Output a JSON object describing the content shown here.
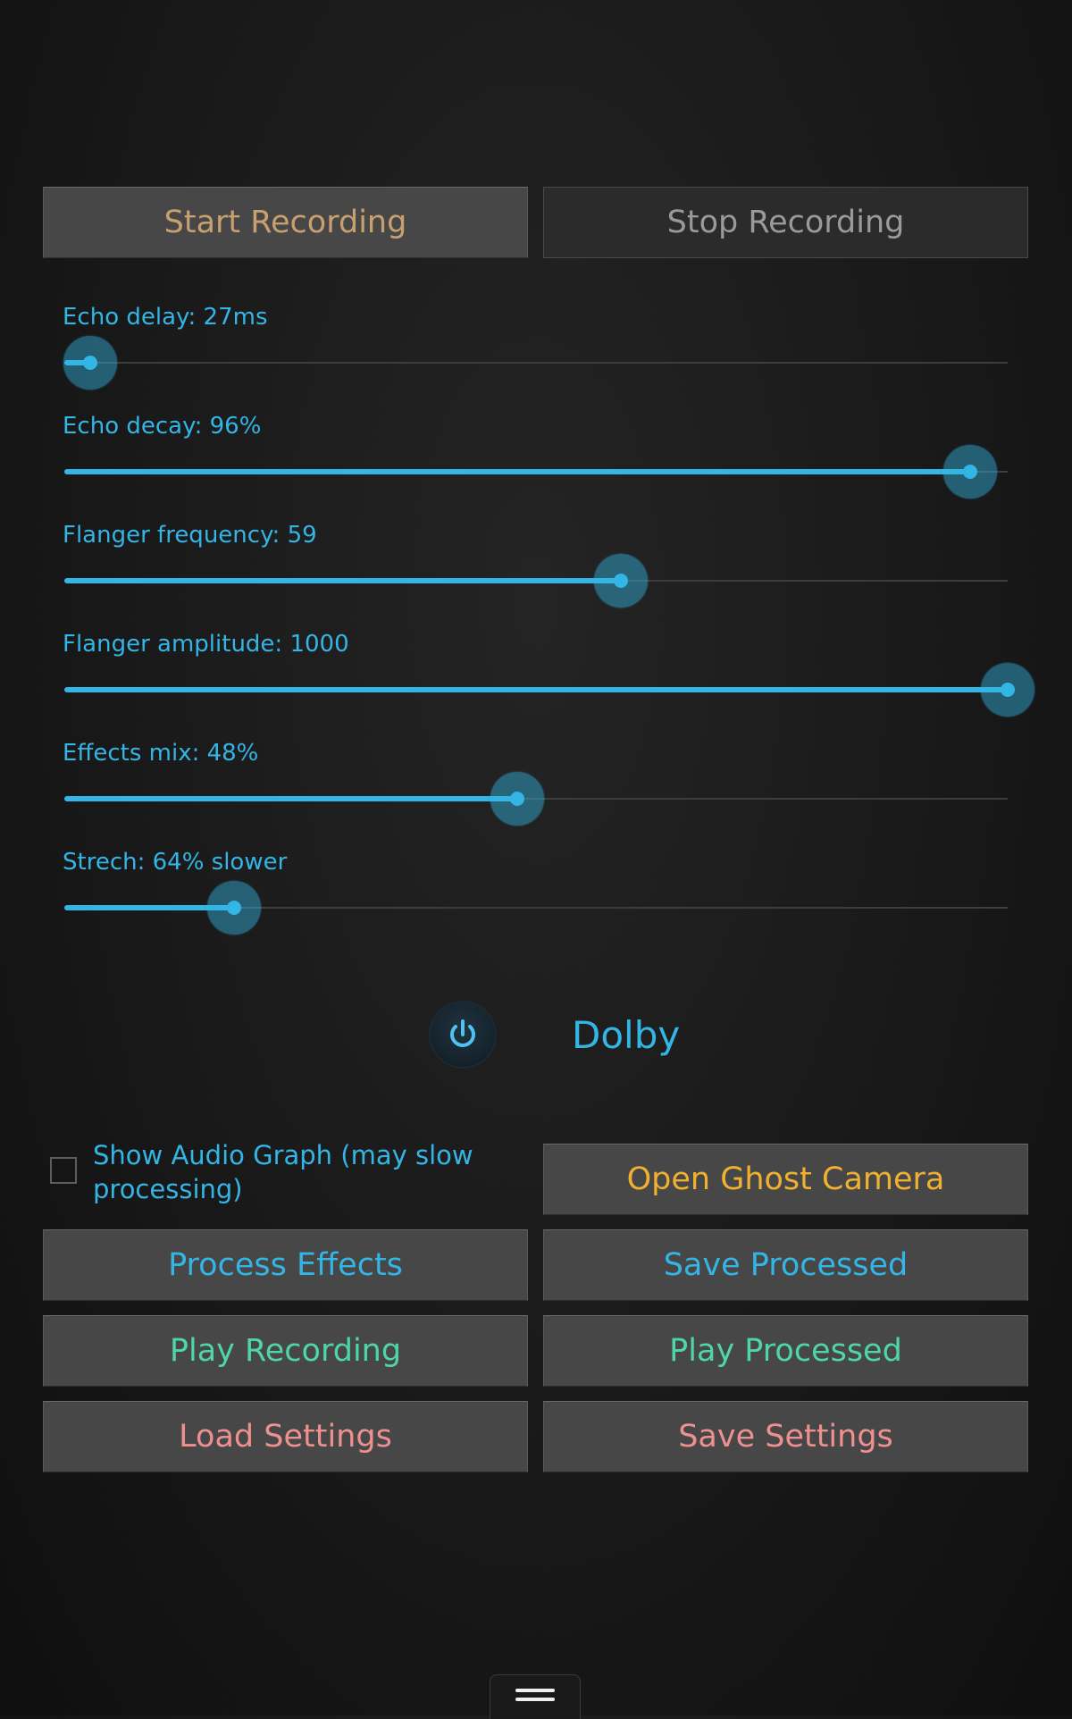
{
  "recording": {
    "start_label": "Start Recording",
    "stop_label": "Stop Recording"
  },
  "sliders": [
    {
      "id": "echo-delay",
      "label": "Echo delay: 27ms",
      "fraction": 0.027
    },
    {
      "id": "echo-decay",
      "label": "Echo decay: 96%",
      "fraction": 0.96
    },
    {
      "id": "flanger-frequency",
      "label": "Flanger frequency: 59",
      "fraction": 0.59
    },
    {
      "id": "flanger-amplitude",
      "label": "Flanger amplitude: 1000",
      "fraction": 1.0
    },
    {
      "id": "effects-mix",
      "label": "Effects mix: 48%",
      "fraction": 0.48
    },
    {
      "id": "stretch",
      "label": "Strech: 64% slower",
      "fraction": 0.18
    }
  ],
  "dolby": {
    "label": "Dolby",
    "icon": "power-icon"
  },
  "audio_graph": {
    "label": "Show Audio Graph (may slow processing)",
    "checked": false
  },
  "actions": {
    "open_ghost_camera": "Open Ghost Camera",
    "process_effects": "Process Effects",
    "save_processed": "Save Processed",
    "play_recording": "Play Recording",
    "play_processed": "Play Processed",
    "load_settings": "Load Settings",
    "save_settings": "Save Settings"
  },
  "menu": {
    "icon": "menu-icon"
  },
  "colors": {
    "accent_blue": "#33b5e5",
    "start_text": "#c8a070",
    "stop_text": "#9a9a9a",
    "orange_text": "#f0b030",
    "green_text": "#4fd6a8",
    "pink_text": "#ee9090",
    "button_bg": "#474747",
    "background": "#1b1b1b"
  }
}
